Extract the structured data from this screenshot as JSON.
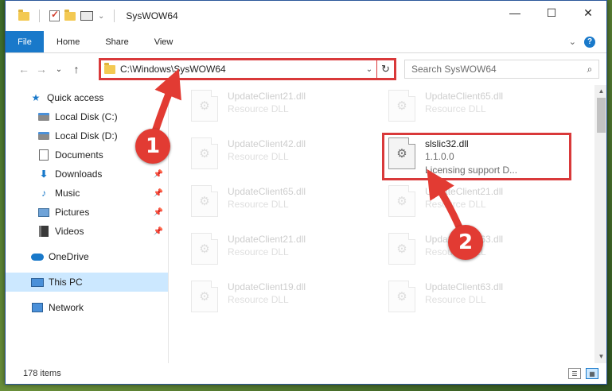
{
  "window": {
    "title": "SysWOW64",
    "buttons": {
      "minimize": "—",
      "maximize": "☐",
      "close": "✕"
    }
  },
  "ribbon": {
    "tabs": [
      "File",
      "Home",
      "Share",
      "View"
    ],
    "expand_glyph": "⌄",
    "help_glyph": "?"
  },
  "navigation": {
    "back": "←",
    "forward": "→",
    "recent": "⌄",
    "up": "↑",
    "address": "C:\\Windows\\SysWOW64",
    "address_caret": "⌄",
    "refresh": "↻",
    "search_placeholder": "Search SysWOW64",
    "search_glyph": "⌕"
  },
  "sidebar": {
    "items": [
      {
        "label": "Quick access",
        "icon": "star-icon",
        "pinned": false
      },
      {
        "label": "Local Disk (C:)",
        "icon": "drive-icon",
        "pinned": false
      },
      {
        "label": "Local Disk (D:)",
        "icon": "drive-icon",
        "pinned": false
      },
      {
        "label": "Documents",
        "icon": "documents-icon",
        "pinned": false
      },
      {
        "label": "Downloads",
        "icon": "downloads-icon",
        "pinned": true
      },
      {
        "label": "Music",
        "icon": "music-icon",
        "pinned": true
      },
      {
        "label": "Pictures",
        "icon": "pictures-icon",
        "pinned": true
      },
      {
        "label": "Videos",
        "icon": "videos-icon",
        "pinned": true
      },
      {
        "label": "OneDrive",
        "icon": "onedrive-icon",
        "pinned": false
      },
      {
        "label": "This PC",
        "icon": "this-pc-icon",
        "pinned": false,
        "selected": true
      },
      {
        "label": "Network",
        "icon": "network-icon",
        "pinned": false
      }
    ],
    "pin_glyph": "📌"
  },
  "files": {
    "left_column": [
      {
        "name": "UpdateClient21.dll",
        "type": "Resource DLL"
      },
      {
        "name": "UpdateClient42.dll",
        "type": "Resource DLL"
      },
      {
        "name": "UpdateClient65.dll",
        "type": "Resource DLL"
      },
      {
        "name": "UpdateClient21.dll",
        "type": "Resource DLL"
      },
      {
        "name": "UpdateClient19.dll",
        "type": "Resource DLL"
      }
    ],
    "right_column": [
      {
        "name": "UpdateClient65.dll",
        "type": "Resource DLL"
      },
      {
        "name": "slslic32.dll",
        "version": "1.1.0.0",
        "description": "Licensing support D...",
        "highlighted": true
      },
      {
        "name": "UpdateClient21.dll",
        "type": "Resource DLL"
      },
      {
        "name": "UpdateClient63.dll",
        "type": "Resource DLL"
      },
      {
        "name": "UpdateClient63.dll",
        "type": "Resource DLL"
      }
    ],
    "file_glyph": "⚙"
  },
  "status": {
    "item_count": "178 items"
  },
  "annotations": {
    "marker_1": "1",
    "marker_2": "2",
    "color": "#e23b33"
  },
  "scrollbar": {
    "up": "▲",
    "down": "▼"
  },
  "colors": {
    "accent": "#1979ca",
    "highlight": "#d9393a",
    "selected_nav": "#cce8ff"
  }
}
